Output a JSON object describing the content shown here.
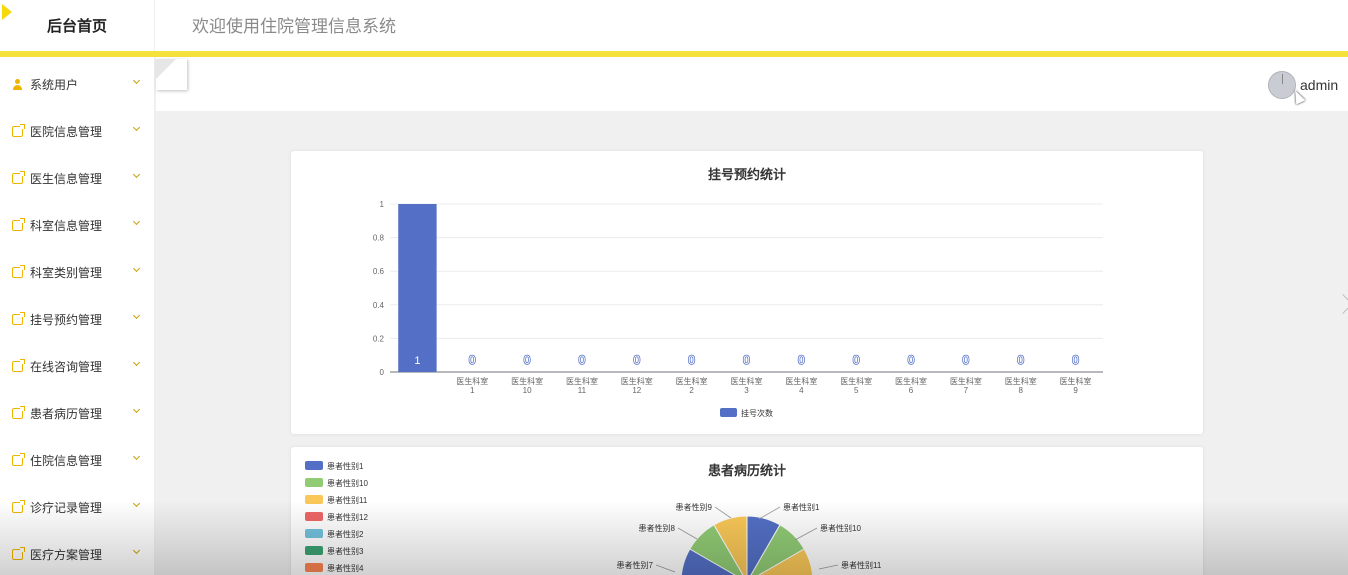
{
  "header": {
    "brand": "后台首页",
    "system_title": "欢迎使用住院管理信息系统"
  },
  "user": {
    "name": "admin"
  },
  "sidebar": {
    "items": [
      {
        "label": "系统用户",
        "icon": "user-icon"
      },
      {
        "label": "医院信息管理",
        "icon": "doc-icon"
      },
      {
        "label": "医生信息管理",
        "icon": "doc-icon"
      },
      {
        "label": "科室信息管理",
        "icon": "doc-icon"
      },
      {
        "label": "科室类别管理",
        "icon": "doc-icon"
      },
      {
        "label": "挂号预约管理",
        "icon": "doc-icon"
      },
      {
        "label": "在线咨询管理",
        "icon": "doc-icon"
      },
      {
        "label": "患者病历管理",
        "icon": "doc-icon"
      },
      {
        "label": "住院信息管理",
        "icon": "doc-icon"
      },
      {
        "label": "诊疗记录管理",
        "icon": "doc-icon"
      },
      {
        "label": "医疗方案管理",
        "icon": "doc-icon"
      }
    ]
  },
  "colors": {
    "accent": "#f5e13c",
    "icon": "#f0b400",
    "bar": "#5470c6"
  },
  "chart_data": [
    {
      "type": "bar",
      "title": "挂号预约统计",
      "categories": [
        "",
        "医生科室1",
        "医生科室10",
        "医生科室11",
        "医生科室12",
        "医生科室2",
        "医生科室3",
        "医生科室4",
        "医生科室5",
        "医生科室6",
        "医生科室7",
        "医生科室8",
        "医生科室9"
      ],
      "series": [
        {
          "name": "挂号次数",
          "values": [
            1,
            0,
            0,
            0,
            0,
            0,
            0,
            0,
            0,
            0,
            0,
            0,
            0
          ]
        }
      ],
      "yticks": [
        "0",
        "0.2",
        "0.4",
        "0.6",
        "0.8",
        "1"
      ],
      "ylim": [
        0,
        1
      ],
      "grid": true,
      "legend": "bottom-center"
    },
    {
      "type": "pie",
      "title": "患者病历统计",
      "legend_items": [
        "患者性别1",
        "患者性别10",
        "患者性别11",
        "患者性别12",
        "患者性别2",
        "患者性别3",
        "患者性别4"
      ],
      "legend_colors": [
        "#5470c6",
        "#91cc75",
        "#fac858",
        "#ee6666",
        "#73c0de",
        "#3ba272",
        "#fc8452"
      ],
      "visible_labels": [
        "患者性别1",
        "患者性别10",
        "患者性别11",
        "患者性别9",
        "患者性别8",
        "患者性别7"
      ],
      "legend": "top-left"
    }
  ]
}
